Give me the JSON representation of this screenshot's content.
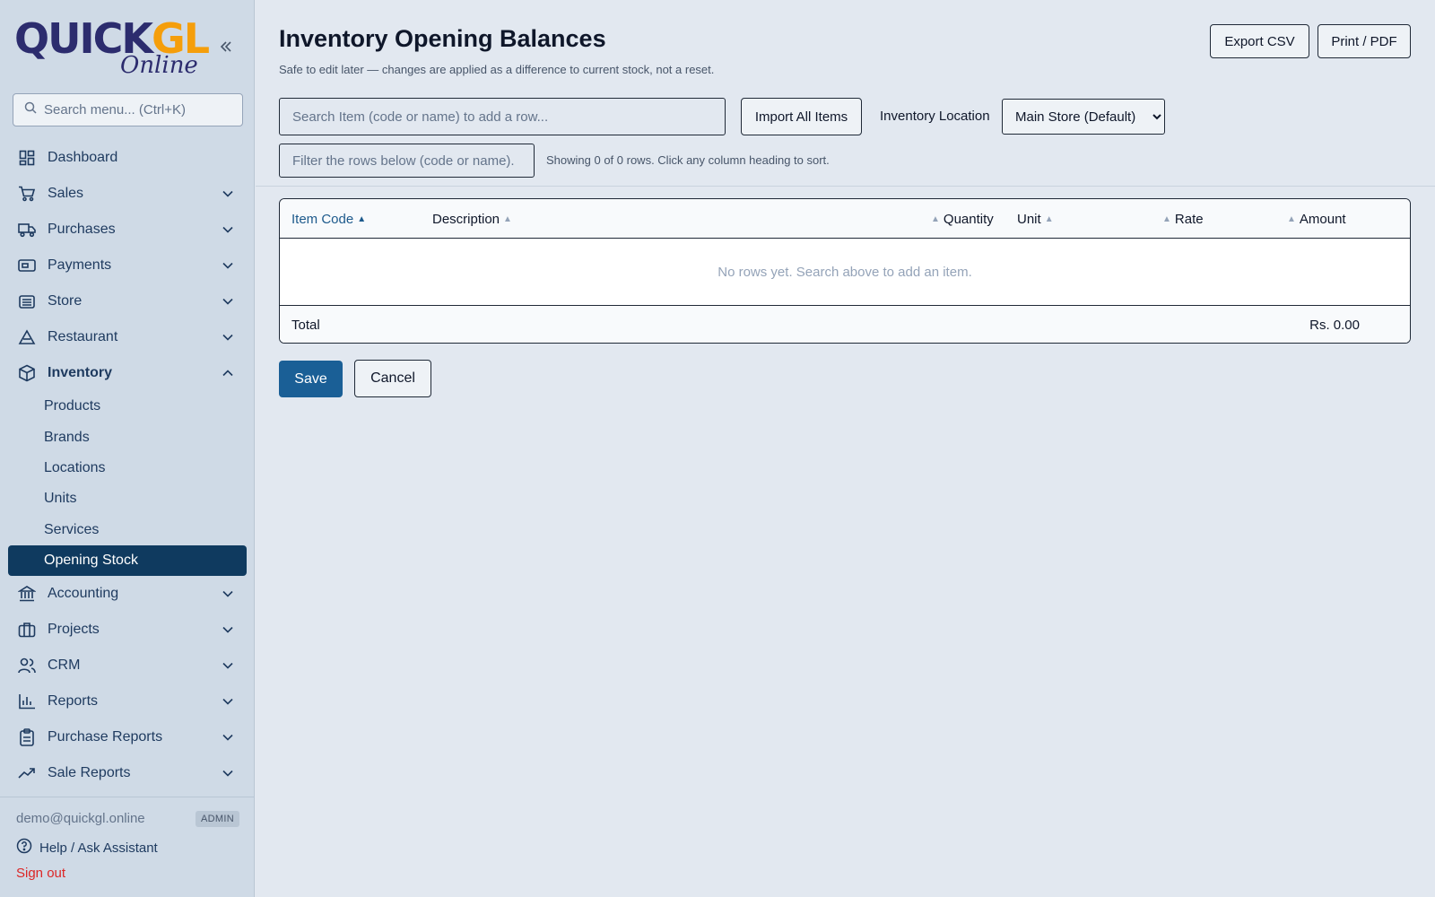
{
  "brand": {
    "logo_main": "QuickGL",
    "logo_sub": "Online"
  },
  "sidebar": {
    "search_placeholder": "Search menu... (Ctrl+K)",
    "items": [
      {
        "label": "Dashboard",
        "icon": "dashboard-icon"
      },
      {
        "label": "Sales",
        "icon": "cart-icon"
      },
      {
        "label": "Purchases",
        "icon": "truck-icon"
      },
      {
        "label": "Payments",
        "icon": "payments-icon"
      },
      {
        "label": "Store",
        "icon": "store-icon"
      },
      {
        "label": "Restaurant",
        "icon": "restaurant-icon"
      },
      {
        "label": "Inventory",
        "icon": "box-icon",
        "expanded": true,
        "children": [
          "Products",
          "Brands",
          "Locations",
          "Units",
          "Services",
          "Opening Stock"
        ],
        "active_child": "Opening Stock"
      },
      {
        "label": "Accounting",
        "icon": "bank-icon"
      },
      {
        "label": "Projects",
        "icon": "briefcase-icon"
      },
      {
        "label": "CRM",
        "icon": "users-icon"
      },
      {
        "label": "Reports",
        "icon": "bar-chart-icon"
      },
      {
        "label": "Purchase Reports",
        "icon": "clipboard-icon"
      },
      {
        "label": "Sale Reports",
        "icon": "trend-icon"
      }
    ],
    "footer": {
      "email": "demo@quickgl.online",
      "role_badge": "ADMIN",
      "help_label": "Help / Ask Assistant",
      "signout_label": "Sign out"
    }
  },
  "main": {
    "title": "Inventory Opening Balances",
    "subtitle": "Safe to edit later — changes are applied as a difference to current stock, not a reset.",
    "export_label": "Export CSV",
    "print_label": "Print / PDF",
    "item_search_placeholder": "Search Item (code or name) to add a row...",
    "import_label": "Import All Items",
    "location_label": "Inventory Location",
    "location_selected": "Main Store (Default)",
    "filter_placeholder": "Filter the rows below (code or name).",
    "rows_info": "Showing 0 of 0 rows. Click any column heading to sort.",
    "table": {
      "columns": [
        "Item Code",
        "Description",
        "Quantity",
        "Unit",
        "Rate",
        "Amount"
      ],
      "sorted_column": "Item Code",
      "sort_direction": "ascending",
      "empty_message": "No rows yet. Search above to add an item.",
      "total_label": "Total",
      "total_value": "Rs. 0.00"
    },
    "save_label": "Save",
    "cancel_label": "Cancel"
  },
  "colors": {
    "accent": "#1a5f96",
    "active_nav": "#0f3a5f",
    "signout": "#dc2626",
    "logo_primary": "#2c2c6e",
    "logo_secondary": "#f59e0b"
  }
}
